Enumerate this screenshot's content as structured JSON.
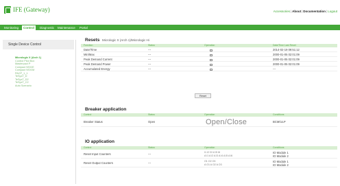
{
  "header": {
    "app_title": "IFE (Gateway)",
    "links": {
      "accessories": "Accessories",
      "about": "About",
      "documentation": "Documentation",
      "logout": "Logout"
    }
  },
  "nav": [
    "Monitoring",
    "Control",
    "Diagnostic",
    "Maintenance",
    "Portal"
  ],
  "sidebar": {
    "title": "Single Device Control",
    "items": [
      "Micrologic X (Arch 1)",
      "Control Pilot Box",
      "Masterpact P",
      "Compact NSX/E",
      "Compact NSX/M",
      "PACP_1_1",
      "TeSysT_D",
      "TeSysT_D2",
      "TeSysT_C2",
      "Auto Scenario"
    ]
  },
  "resets": {
    "title": "Resets",
    "subtitle": "Micrologic X (Arch 1)/Micrologic Hi",
    "headers": [
      "Function",
      "Status",
      "Operation",
      "Date/Time Last Reset"
    ],
    "rows": [
      {
        "function": "Date/Time",
        "status": "---",
        "date": "2014-02-19 09:51:12"
      },
      {
        "function": "Min/Max",
        "status": "---",
        "date": "2000-01-05 02:01:09"
      },
      {
        "function": "Peak Demand Current",
        "status": "---",
        "date": "2000-01-05 02:01:09"
      },
      {
        "function": "Peak Demand Power",
        "status": "---",
        "date": "2000-01-05 02:01:09"
      },
      {
        "function": "Accumulated Energy",
        "status": "---",
        "date": "---"
      }
    ],
    "reset_button": "Reset"
  },
  "breaker": {
    "title": "Breaker application",
    "headers": [
      "Control",
      "Status",
      "Operation",
      "Conditions"
    ],
    "row": {
      "control": "Breaker Status",
      "status": "Open",
      "operation": "Open/Close",
      "conditions": "BCM/ULP"
    }
  },
  "io": {
    "title": "IO application",
    "headers": [
      "Control",
      "Status",
      "Operation",
      "Conditions"
    ],
    "rows": [
      {
        "control": "Reset Input Counters",
        "status": "---",
        "op_line1": "I1  I2  I3  I4  I5  I6",
        "op_line2": "A  I1  A  I2  A  I3  A  I4  A  I5  A  I6",
        "cond_line1": "IO Module 1",
        "cond_line2": "IO Module 2"
      },
      {
        "control": "Reset Output Counters",
        "status": "---",
        "op_line1": "O1  O2  O3",
        "op_line2": "A  O1  A  O2  A  O3",
        "cond_line1": "IO Module 1",
        "cond_line2": "IO Module 2"
      }
    ]
  }
}
